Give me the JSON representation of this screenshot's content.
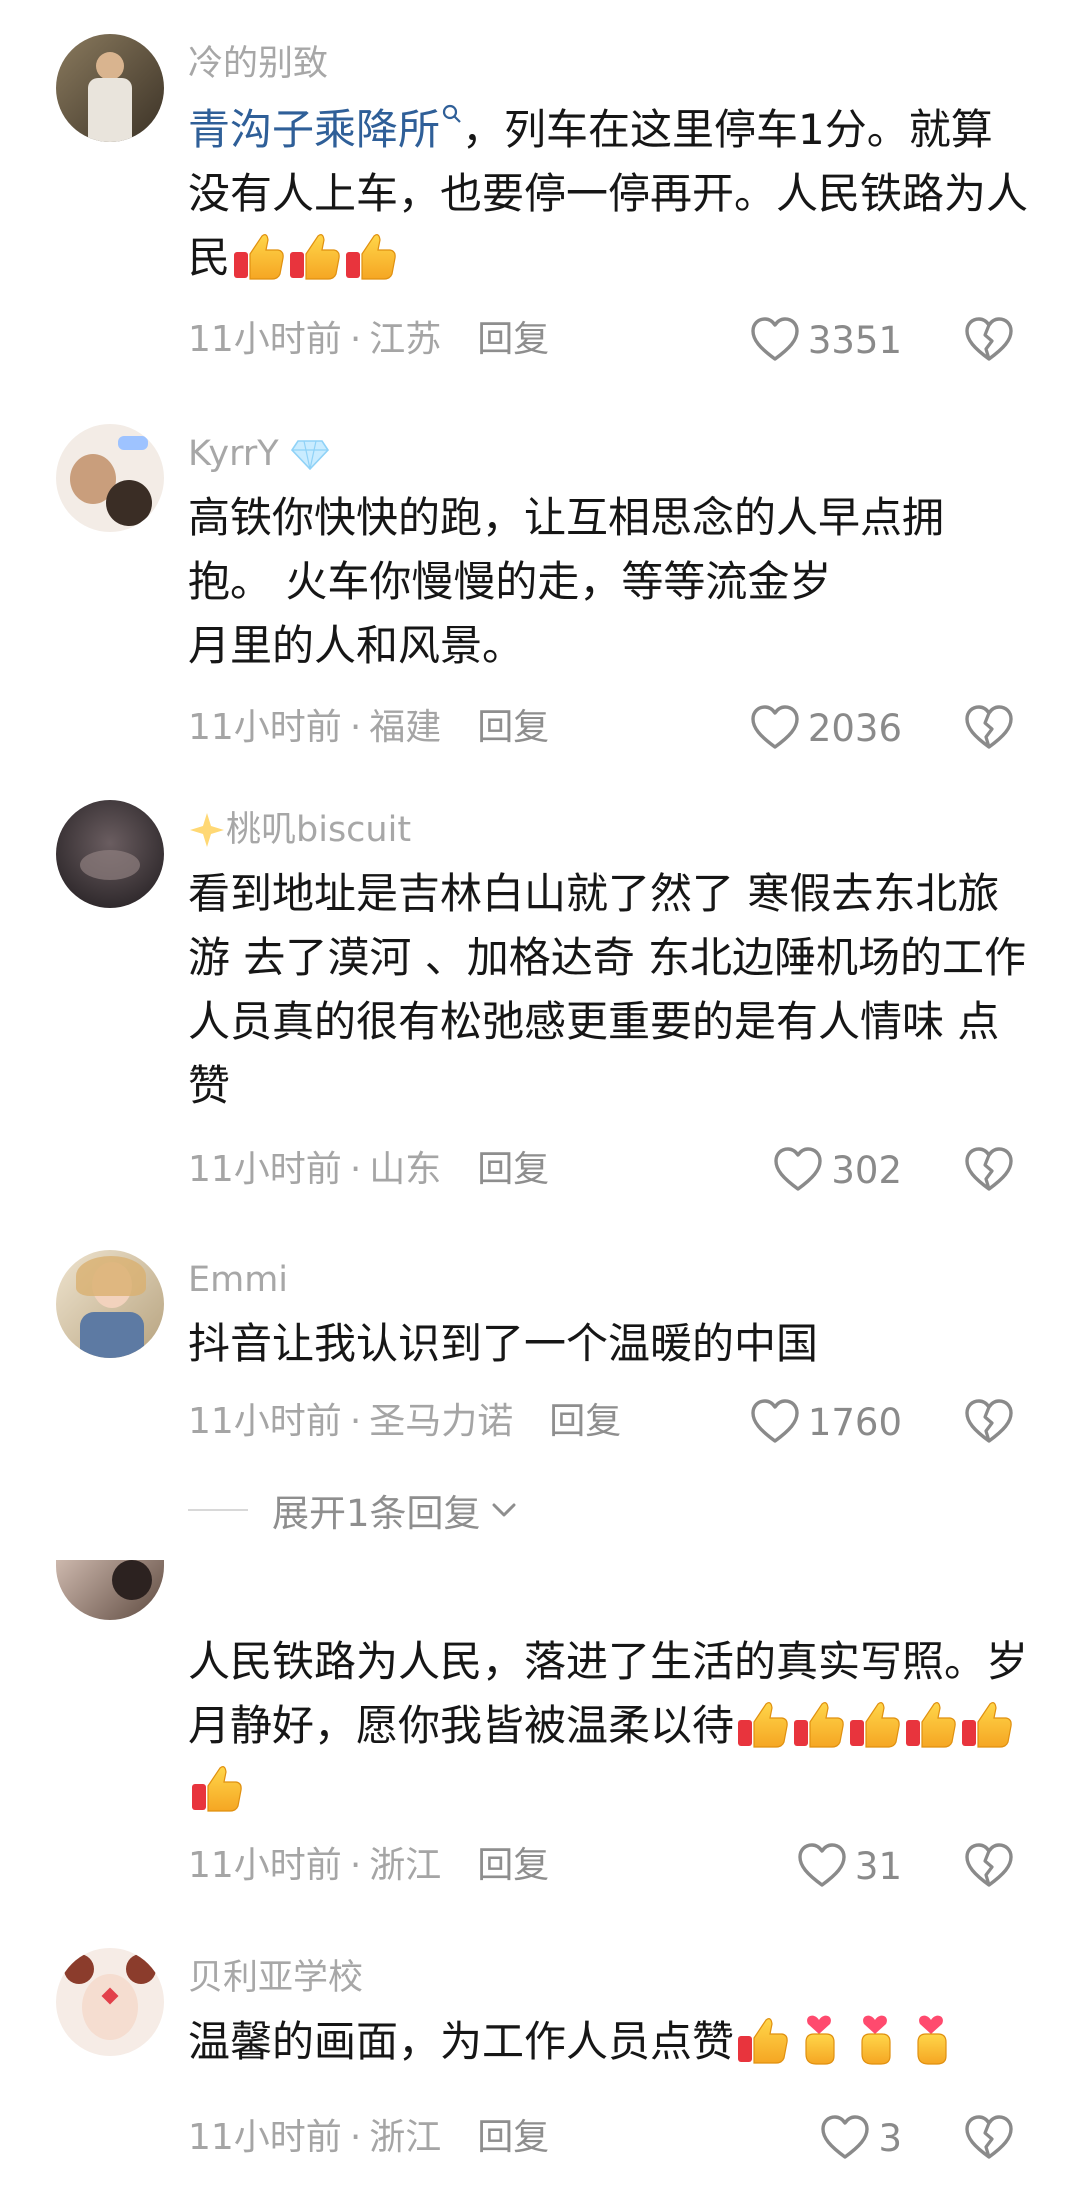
{
  "comments": [
    {
      "username": "冷的别致",
      "mention": "青沟子乘降所",
      "text_after_mention": "，列车在这里停车1分。就算没有人上车，也要停一停再开。人民铁路为人民",
      "time": "11小时前",
      "location": "江苏",
      "reply_label": "回复",
      "likes": "3351",
      "emojis": [
        "thumbs-up",
        "thumbs-up",
        "thumbs-up"
      ]
    },
    {
      "username": "KyrrY",
      "text_line1": "高铁你快快的跑，让互相思念的人早点拥",
      "text_line2": "抱。 火车你慢慢的走，等等流金岁",
      "text_line3": "月里的人和风景。",
      "time": "11小时前",
      "location": "福建",
      "reply_label": "回复",
      "likes": "2036"
    },
    {
      "username": "桃叽biscuit",
      "text": "看到地址是吉林白山就了然了 寒假去东北旅游 去了漠河 、加格达奇 东北边陲机场的工作人员真的很有松弛感更重要的是有人情味 点赞",
      "time": "11小时前",
      "location": "山东",
      "reply_label": "回复",
      "likes": "302"
    },
    {
      "username": "Emmi",
      "text": "抖音让我认识到了一个温暖的中国",
      "time": "11小时前",
      "location": "圣马力诺",
      "reply_label": "回复",
      "likes": "1760",
      "expand_label": "展开1条回复"
    },
    {
      "text": "人民铁路为人民，落进了生活的真实写照。岁月静好，愿你我皆被温柔以待",
      "time": "11小时前",
      "location": "浙江",
      "reply_label": "回复",
      "likes": "31",
      "emojis": [
        "thumbs-up",
        "thumbs-up",
        "thumbs-up",
        "thumbs-up",
        "thumbs-up",
        "thumbs-up"
      ]
    },
    {
      "username": "贝利亚学校",
      "text": "温馨的画面，为工作人员点赞",
      "time": "11小时前",
      "location": "浙江",
      "reply_label": "回复",
      "likes": "3",
      "emojis": [
        "thumbs-up",
        "finger-heart",
        "finger-heart",
        "finger-heart"
      ]
    }
  ],
  "separator": "·",
  "colors": {
    "mention": "#2f5f98",
    "meta": "#a5a5a5",
    "username": "#a7a7a7",
    "text": "#161616"
  }
}
